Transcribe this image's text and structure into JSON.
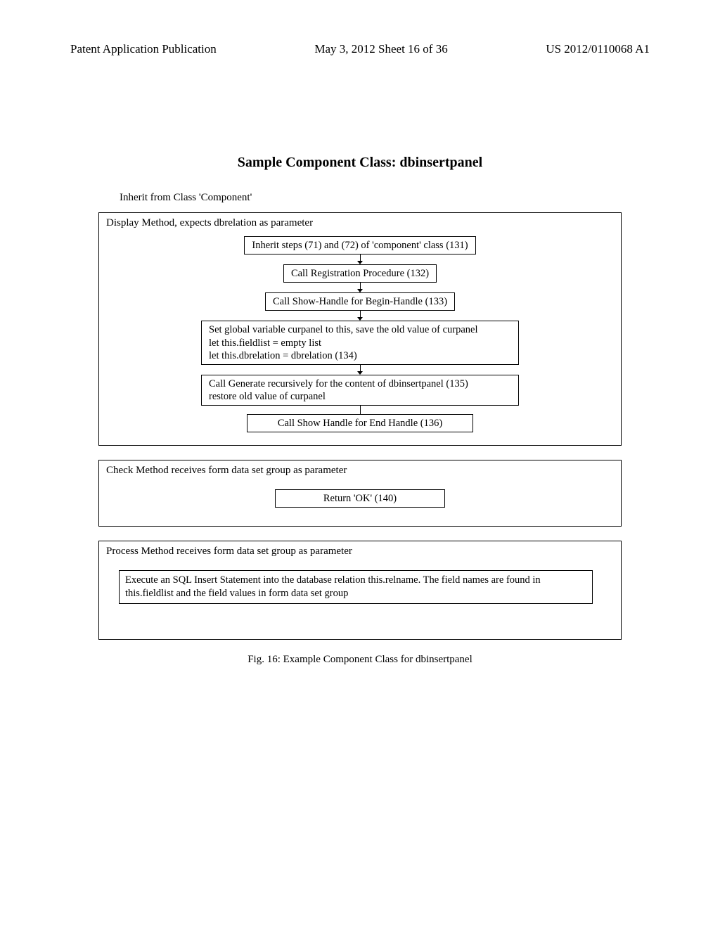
{
  "header": {
    "left": "Patent Application Publication",
    "center": "May 3, 2012  Sheet 16 of 36",
    "right": "US 2012/0110068 A1"
  },
  "title": "Sample Component Class: dbinsertpanel",
  "inherit": "Inherit from Class 'Component'",
  "display_method": {
    "label": "Display Method, expects dbrelation as parameter",
    "steps": {
      "s1": "Inherit steps (71) and (72) of 'component' class (131)",
      "s2": "Call Registration Procedure (132)",
      "s3": "Call Show-Handle for Begin-Handle (133)",
      "s4": "Set global variable curpanel to this, save the old value of curpanel\nlet this.fieldlist = empty list\nlet this.dbrelation = dbrelation (134)",
      "s5": "Call Generate recursively for the content of dbinsertpanel (135)\nrestore old value of curpanel",
      "s6": "Call Show Handle for End Handle (136)"
    }
  },
  "check_method": {
    "label": "Check Method   receives form data set group as parameter",
    "step": "Return 'OK' (140)"
  },
  "process_method": {
    "label": "Process Method  receives form data set group as parameter",
    "inner": "Execute an SQL Insert Statement into the database relation this.relname. The field names are found in this.fieldlist and the field values in form data set group"
  },
  "caption": "Fig. 16: Example Component Class for dbinsertpanel"
}
